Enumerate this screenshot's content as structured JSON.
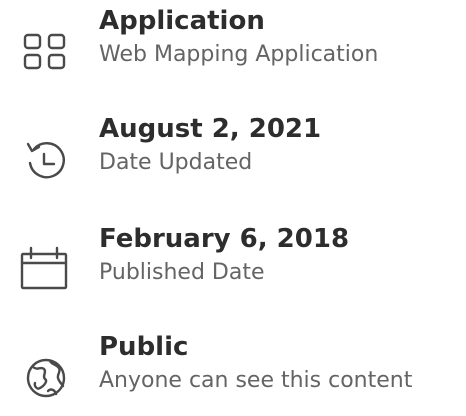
{
  "details": {
    "items": [
      {
        "icon": "grid-icon",
        "title": "Application",
        "subtitle": "Web Mapping Application"
      },
      {
        "icon": "history-icon",
        "title": "August 2, 2021",
        "subtitle": "Date Updated"
      },
      {
        "icon": "calendar-icon",
        "title": "February 6, 2018",
        "subtitle": "Published Date"
      },
      {
        "icon": "globe-icon",
        "title": "Public",
        "subtitle": "Anyone can see this content"
      }
    ]
  }
}
